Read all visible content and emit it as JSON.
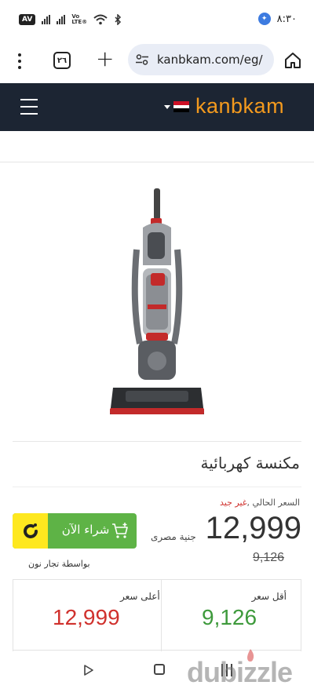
{
  "status_bar": {
    "network_badge": "AV",
    "volte_top": "Vo",
    "volte_bottom": "LTE®",
    "time": "٨:٣٠"
  },
  "browser": {
    "tab_count": "٢٦",
    "url": "kanbkam.com/eg/",
    "icons": [
      "menu-dots-icon",
      "tabs-icon",
      "new-tab-icon",
      "site-settings-icon",
      "home-icon"
    ]
  },
  "site_header": {
    "logo_text": "kanbkam",
    "icons": [
      "hamburger-icon",
      "egypt-flag-icon",
      "caret-down-icon"
    ]
  },
  "product": {
    "title": "مكنسة كهربائية",
    "price_label": "السعر الحالي ,",
    "price_condition": "غير جيد",
    "current_price": "12,999",
    "currency": "جنية مصرى",
    "old_price": "9,126",
    "buy_button_label": "شراء الآن",
    "seller": "بواسطة تجار نون"
  },
  "stats": {
    "lowest_label": "أقل سعر",
    "lowest_value": "9,126",
    "highest_label": "أعلى سعر",
    "highest_value": "12,999"
  },
  "watermark": "dubizzle",
  "colors": {
    "header_bg": "#1c2533",
    "buy_green": "#5eb346",
    "noon_yellow": "#fee81f",
    "low_green": "#3e9a3c",
    "high_red": "#d0312d"
  }
}
